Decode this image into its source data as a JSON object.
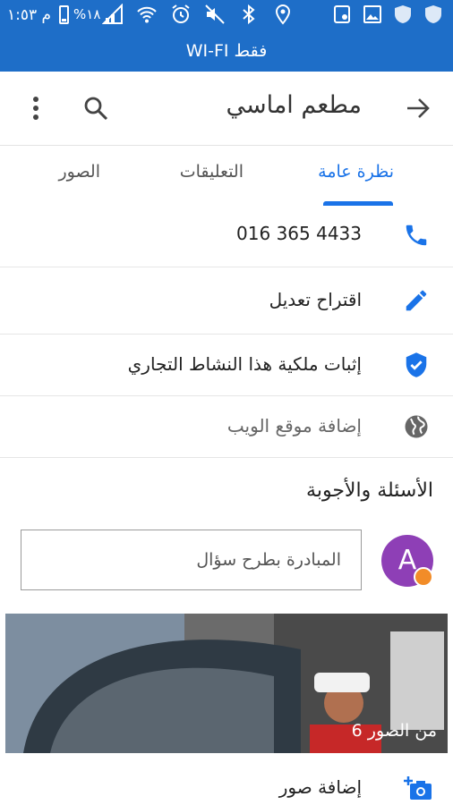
{
  "status_bar": {
    "time": "م ١:٥٣",
    "battery": "%١٨",
    "icons": [
      "signal-icon",
      "wifi-icon",
      "alarm-icon",
      "mute-icon",
      "bluetooth-icon",
      "location-icon",
      "screen-record-icon",
      "gallery-icon",
      "shield-icon",
      "shield-icon"
    ]
  },
  "wifi_banner": "WI-FI فقط",
  "toolbar": {
    "title": "مطعم اماسي"
  },
  "tabs": [
    {
      "label": "نظرة عامة",
      "active": true
    },
    {
      "label": "التعليقات",
      "active": false
    },
    {
      "label": "الصور",
      "active": false
    }
  ],
  "details": {
    "phone": "016 365 4433",
    "suggest_edit": "اقتراح تعديل",
    "claim_business": "إثبات ملكية هذا النشاط التجاري",
    "add_website": "إضافة موقع الويب"
  },
  "qa": {
    "title": "الأسئلة والأجوبة",
    "avatar_letter": "A",
    "ask_placeholder": "المبادرة بطرح سؤال"
  },
  "photos": {
    "count_label": "6 من الصور"
  },
  "add_photos": {
    "label": "إضافة صور"
  },
  "colors": {
    "accent": "#1a73e8",
    "status_bar": "#1e6ec8",
    "avatar": "#8e3fb6"
  }
}
